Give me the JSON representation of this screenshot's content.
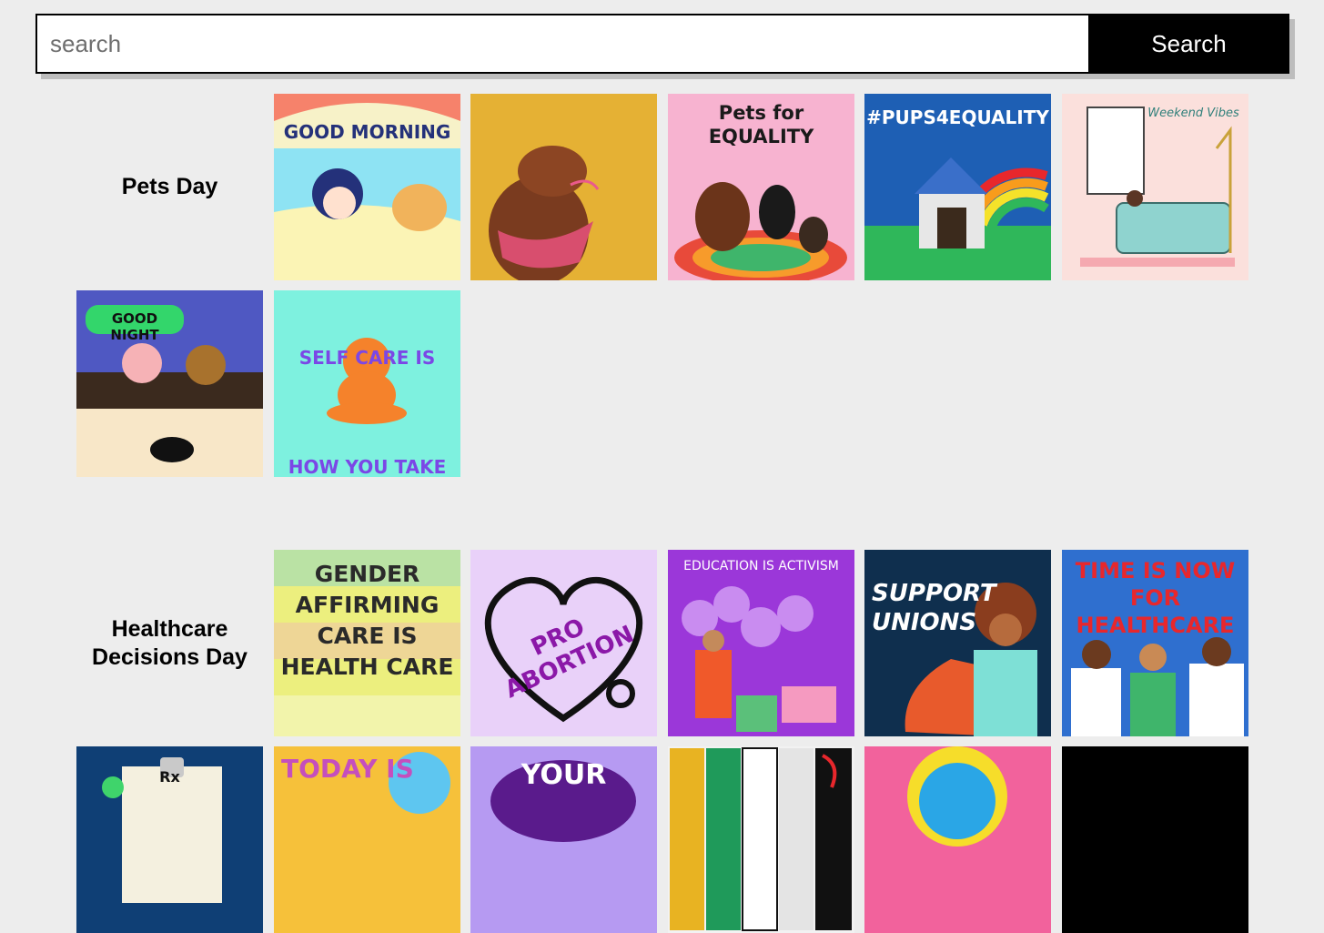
{
  "search": {
    "placeholder": "search",
    "value": "",
    "button_label": "Search"
  },
  "sections": [
    {
      "title": "Pets Day",
      "tiles": [
        {
          "caption": "GOOD MORNING",
          "bg": "#8ee3f3",
          "accent": "#f6826b"
        },
        {
          "caption": "",
          "bg": "#e5b134",
          "accent": "#7a3b1f"
        },
        {
          "caption": "Pets for EQUALITY",
          "bg": "#f7b3d0",
          "accent": "#e84a3a"
        },
        {
          "caption": "#PUPS4EQUALITY",
          "bg": "#1e5fb4",
          "accent": "#ffffff"
        },
        {
          "caption": "Weekend Vibes",
          "bg": "#fbe0dc",
          "accent": "#8fd3cf"
        },
        {
          "caption": "GOOD NIGHT",
          "bg": "#4f58c2",
          "accent": "#33d66b"
        },
        {
          "caption": "SELF CARE IS HOW YOU TAKE YOUR POWER BACK",
          "bg": "#7ef1df",
          "accent": "#7b47e6"
        }
      ]
    },
    {
      "title": "Healthcare Decisions Day",
      "tiles": [
        {
          "caption": "GENDER AFFIRMING CARE IS HEALTH CARE",
          "bg": "#ecef7e",
          "accent": "#5ecbeb"
        },
        {
          "caption": "PRO ABORTION",
          "bg": "#e9d1f9",
          "accent": "#8b18a8"
        },
        {
          "caption": "EDUCATION IS ACTIVISM",
          "bg": "#9b37d9",
          "accent": "#ffffff"
        },
        {
          "caption": "SUPPORT UNIONS",
          "bg": "#0f2f4e",
          "accent": "#ffffff"
        },
        {
          "caption": "TIME IS NOW FOR HEALTHCARE",
          "bg": "#2f6fcf",
          "accent": "#e8272c"
        },
        {
          "caption": "Rx",
          "bg": "#0f3f75",
          "accent": "#f4f0df"
        },
        {
          "caption": "TODAY IS",
          "bg": "#f6c13a",
          "accent": "#c54fbd"
        },
        {
          "caption": "YOUR",
          "bg": "#b69af2",
          "accent": "#5a1b8c"
        },
        {
          "caption": "",
          "bg": "#f2f2f2",
          "accent": "#e8b322"
        },
        {
          "caption": "",
          "bg": "#f2629c",
          "accent": "#2aa6e6"
        },
        {
          "caption": "",
          "bg": "#000000",
          "accent": "#000000"
        }
      ]
    }
  ]
}
